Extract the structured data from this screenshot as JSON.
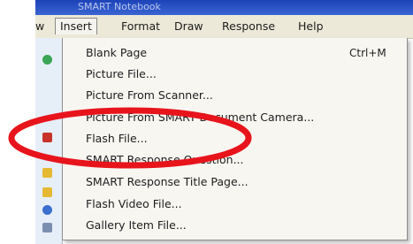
{
  "window": {
    "title": "SMART Notebook"
  },
  "menubar": {
    "partial_item": "w",
    "items": [
      {
        "label": "Insert",
        "active": true
      },
      {
        "label": "Format"
      },
      {
        "label": "Draw"
      },
      {
        "label": "Response"
      },
      {
        "label": "Help"
      }
    ]
  },
  "insert_menu": {
    "items": [
      {
        "label": "Blank Page",
        "shortcut": "Ctrl+M"
      },
      {
        "label": "Picture File..."
      },
      {
        "label": "Picture From Scanner..."
      },
      {
        "label": "Picture From SMART Document Camera..."
      },
      {
        "label": "Flash File..."
      },
      {
        "label": "SMART Response Question..."
      },
      {
        "label": "SMART Response Title Page..."
      },
      {
        "label": "Flash Video File..."
      },
      {
        "label": "Gallery Item File..."
      }
    ]
  },
  "annotation": {
    "highlight_color": "#e8141c",
    "encircled_item": "Flash File..."
  },
  "colors": {
    "menubar_bg": "#ece9d8",
    "menu_bg": "#f7f6f1",
    "titlebar": "#1d43b8"
  }
}
